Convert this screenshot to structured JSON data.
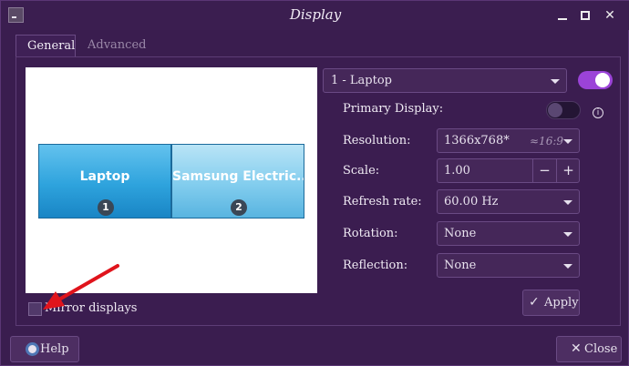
{
  "window": {
    "title": "Display"
  },
  "tabs": [
    {
      "label": "General",
      "active": true
    },
    {
      "label": "Advanced",
      "active": false
    }
  ],
  "preview": {
    "monitors": [
      {
        "label": "Laptop",
        "number": "1"
      },
      {
        "label": "Samsung Electric...",
        "number": "2"
      }
    ]
  },
  "mirror": {
    "label": "Mirror displays",
    "checked": false
  },
  "display_select": {
    "value": "1 - Laptop",
    "enabled": true
  },
  "settings": {
    "primary_display": {
      "label": "Primary Display:",
      "on": false
    },
    "resolution": {
      "label": "Resolution:",
      "value": "1366x768*",
      "ratio": "≈16:9"
    },
    "scale": {
      "label": "Scale:",
      "value": "1.00",
      "minus": "−",
      "plus": "+"
    },
    "refresh_rate": {
      "label": "Refresh rate:",
      "value": "60.00 Hz"
    },
    "rotation": {
      "label": "Rotation:",
      "value": "None"
    },
    "reflection": {
      "label": "Reflection:",
      "value": "None"
    }
  },
  "buttons": {
    "apply": "Apply",
    "help": "Help",
    "close": "Close"
  },
  "colors": {
    "accent": "#9b43d8",
    "window_bg": "#3a1d4f",
    "annotation_arrow": "#e0141c"
  }
}
